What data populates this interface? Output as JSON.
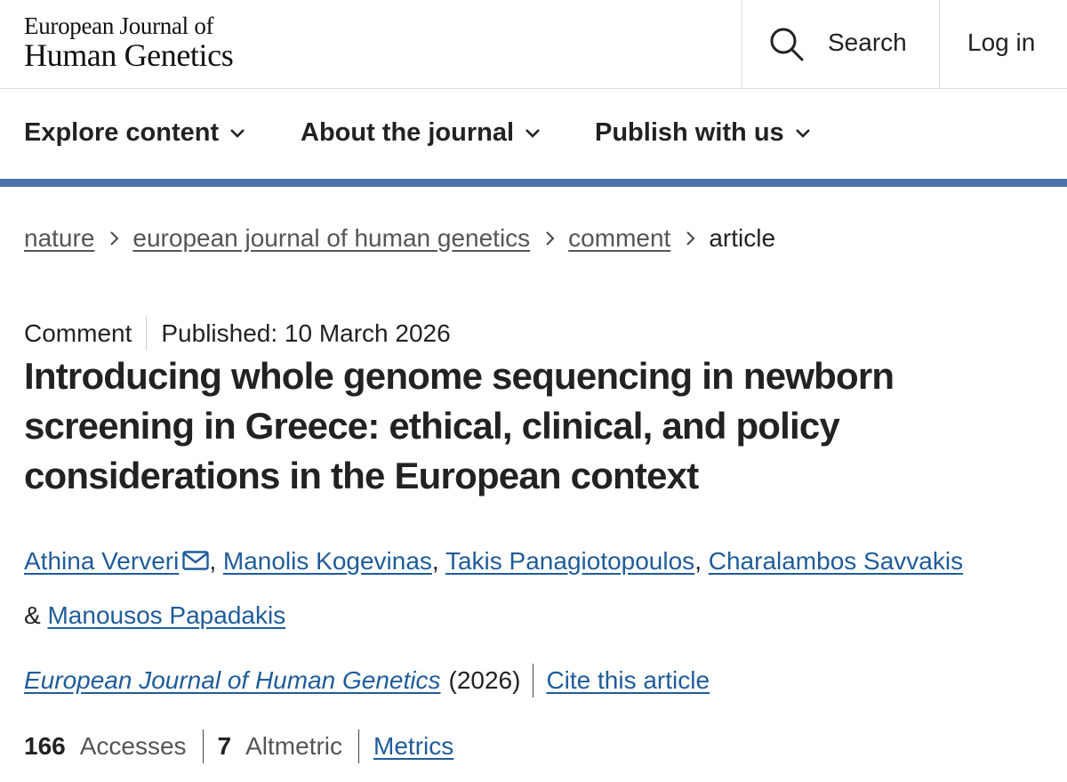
{
  "header": {
    "logo_line1": "European Journal of",
    "logo_line2": "Human Genetics",
    "search_label": "Search",
    "login_label": "Log in"
  },
  "nav": {
    "items": [
      {
        "label": "Explore content"
      },
      {
        "label": "About the journal"
      },
      {
        "label": "Publish with us"
      }
    ]
  },
  "breadcrumb": {
    "items": [
      "nature",
      "european journal of human genetics",
      "comment"
    ],
    "current": "article"
  },
  "article": {
    "type": "Comment",
    "published": "Published: 10 March 2026",
    "title": "Introducing whole genome sequencing in newborn screening in Greece: ethical, clinical, and policy considerations in the European context",
    "authors": [
      "Athina Ververi",
      "Manolis Kogevinas",
      "Takis Panagiotopoulos",
      "Charalambos Savvakis",
      "Manousos Papadakis"
    ],
    "separators": {
      "comma": ",",
      "and": "&"
    },
    "journal": "European Journal of Human Genetics",
    "year": "(2026)",
    "cite_label": "Cite this article",
    "metrics": {
      "accesses_count": "166",
      "accesses_label": "Accesses",
      "altmetric_count": "7",
      "altmetric_label": "Altmetric",
      "metrics_link": "Metrics"
    }
  },
  "colors": {
    "accent_rule": "#4a74aa",
    "link": "#1f5c99",
    "text": "#222222"
  }
}
